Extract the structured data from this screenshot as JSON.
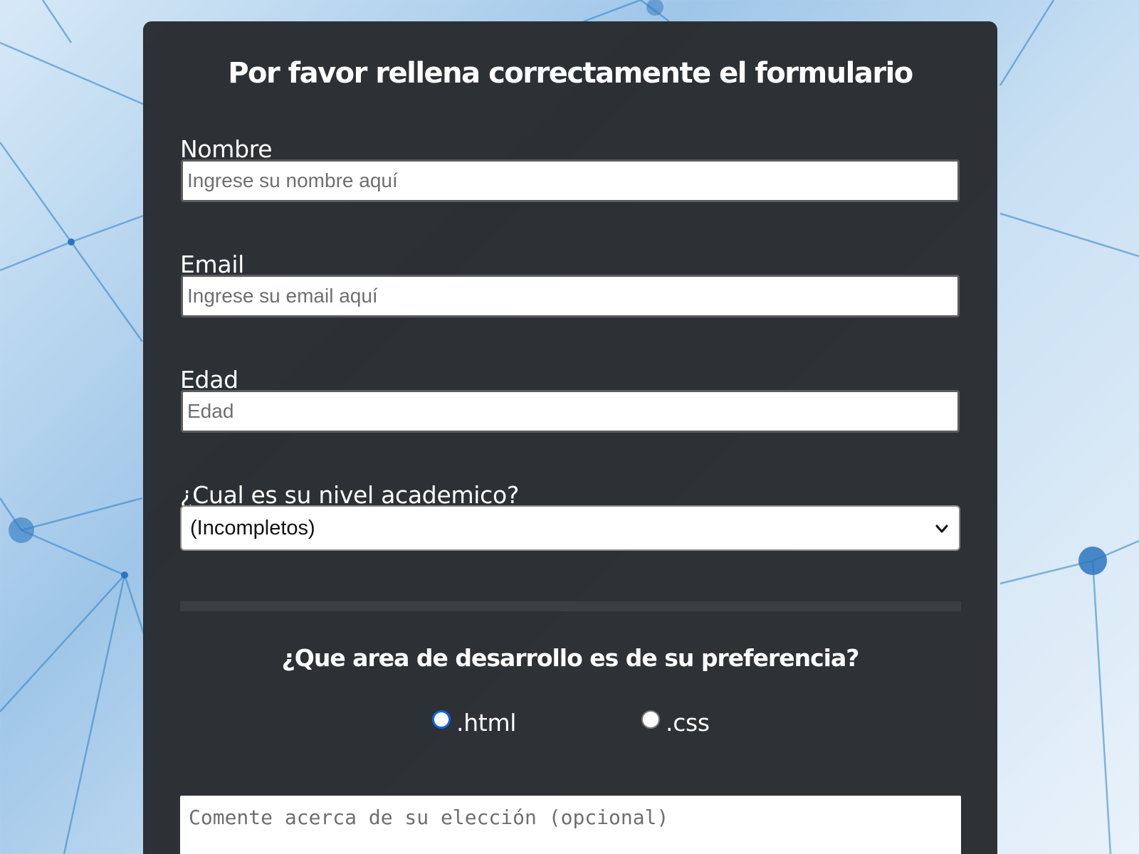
{
  "form": {
    "title": "Por favor rellena correctamente el formulario",
    "name": {
      "label": "Nombre",
      "placeholder": "Ingrese su nombre aquí",
      "value": ""
    },
    "email": {
      "label": "Email",
      "placeholder": "Ingrese su email aquí",
      "value": ""
    },
    "age": {
      "label": "Edad",
      "placeholder": "Edad",
      "value": ""
    },
    "education": {
      "label": "¿Cual es su nivel academico?",
      "selected": "(Incompletos)",
      "icon": "chevron-down-icon"
    },
    "preference": {
      "question": "¿Que area de desarrollo es de su preferencia?",
      "options": [
        {
          "label": ".html",
          "checked": true
        },
        {
          "label": ".css",
          "checked": false
        }
      ]
    },
    "comment": {
      "placeholder": "Comente acerca de su elección (opcional)",
      "value": ""
    }
  },
  "colors": {
    "card_background": "#282b2e",
    "text": "#ffffff",
    "radio_accent": "#0a66e8",
    "divider": "#3b3f44"
  }
}
